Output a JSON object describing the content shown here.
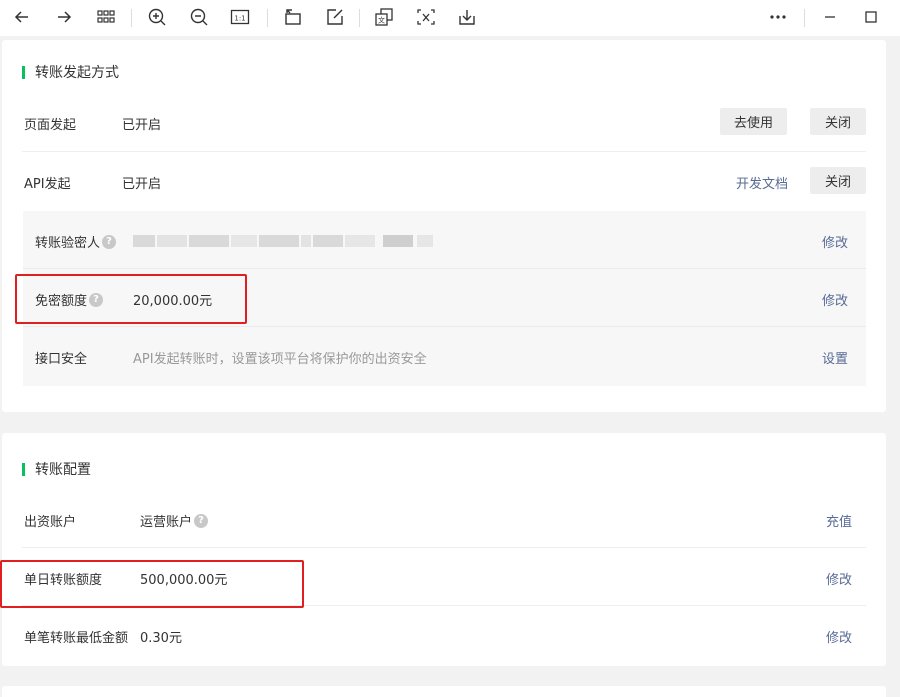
{
  "toolbar": {
    "icons": [
      "arrow-left-icon",
      "arrow-right-icon",
      "grid-icon",
      "zoom-in-icon",
      "zoom-out-icon",
      "actual-size-icon",
      "rotate-icon",
      "edit-icon",
      "screenshot-translate-icon",
      "ocr-icon",
      "download-icon",
      "more-icon",
      "minimize-icon",
      "maximize-icon"
    ],
    "actual_size_label": "1:1",
    "ocr_label": "文"
  },
  "section1": {
    "title": "转账发起方式",
    "page_initiate": {
      "label": "页面发起",
      "value": "已开启",
      "use_button": "去使用",
      "close_button": "关闭"
    },
    "api_initiate": {
      "label": "API发起",
      "value": "已开启",
      "docs_link": "开发文档",
      "close_button": "关闭"
    },
    "verifier": {
      "label": "转账验密人",
      "action": "修改"
    },
    "password_free_limit": {
      "label": "免密额度",
      "value": "20,000.00元",
      "action": "修改"
    },
    "api_security": {
      "label": "接口安全",
      "desc": "API发起转账时，设置该项平台将保护你的出资安全",
      "action": "设置"
    }
  },
  "section2": {
    "title": "转账配置",
    "funding_account": {
      "label": "出资账户",
      "value": "运营账户",
      "action": "充值"
    },
    "daily_limit": {
      "label": "单日转账额度",
      "value": "500,000.00元",
      "action": "修改"
    },
    "min_amount": {
      "label": "单笔转账最低金额",
      "value": "0.30元",
      "action": "修改"
    }
  },
  "colors": {
    "accent": "#07c160",
    "link": "#576b95",
    "highlight": "#e02020"
  }
}
